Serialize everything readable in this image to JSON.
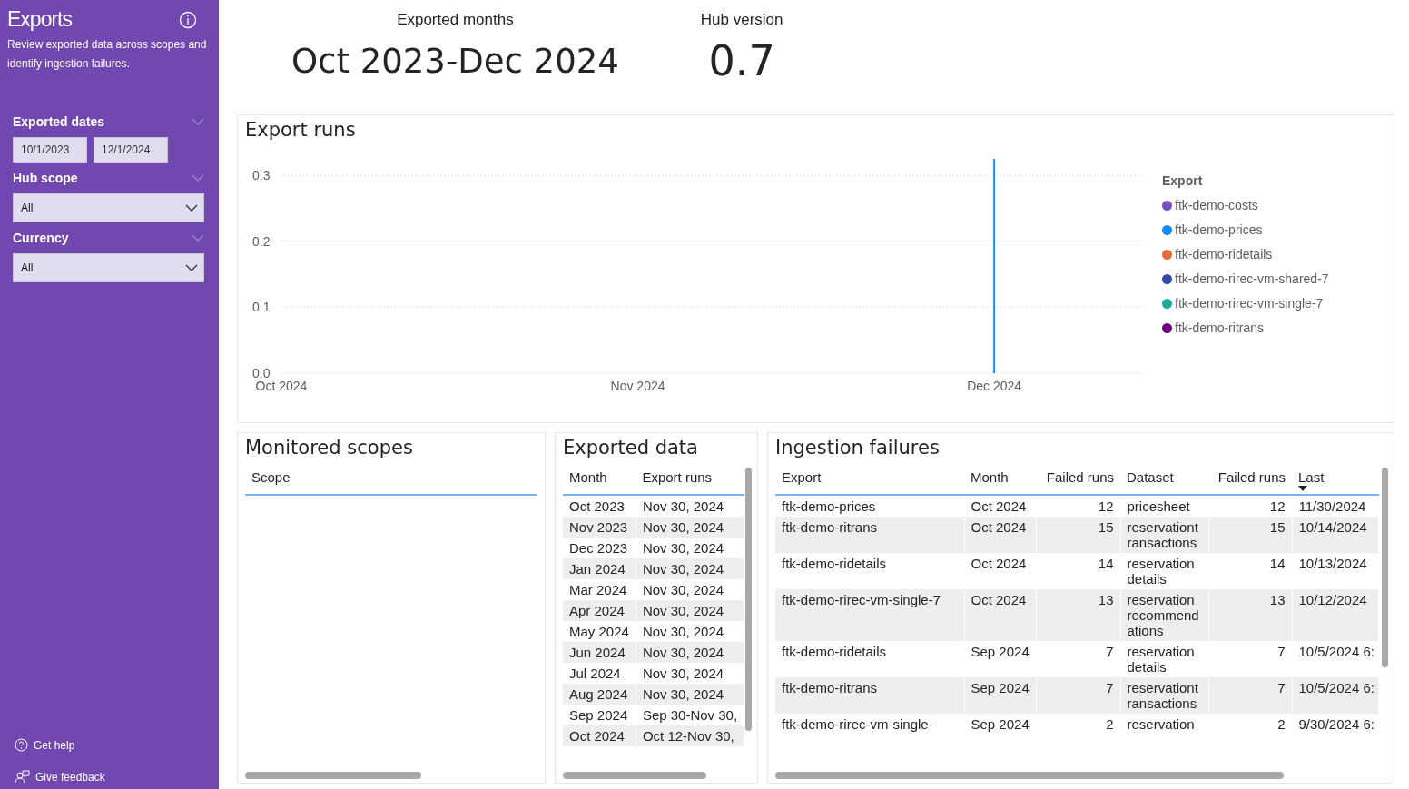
{
  "sidebar": {
    "title": "Exports",
    "subtitle": "Review exported data across scopes and identify ingestion failures.",
    "filters": [
      {
        "kind": "dates",
        "label": "Exported dates",
        "values": [
          "10/1/2023",
          "12/1/2024"
        ]
      },
      {
        "kind": "dropdown",
        "label": "Hub scope",
        "value": "All"
      },
      {
        "kind": "dropdown",
        "label": "Currency",
        "value": "All"
      }
    ],
    "footer_links": [
      {
        "kind": "help",
        "label": "Get help"
      },
      {
        "kind": "feedback",
        "label": "Give feedback"
      }
    ]
  },
  "kpis": [
    {
      "label": "Exported months",
      "value": "Oct 2023-Dec 2024"
    },
    {
      "label": "Hub version",
      "value": "0.7"
    }
  ],
  "export_runs": {
    "title": "Export runs",
    "chart_data": {
      "type": "line",
      "categories": [
        "Oct 2024",
        "Nov 2024",
        "Dec 2024"
      ],
      "ylim": [
        0,
        0.3
      ],
      "grid": true,
      "ref_lines": [
        {
          "axis": "x",
          "value": "Dec 2024",
          "color": "#118dff"
        }
      ],
      "yticks": [
        {
          "value": 0,
          "label": "0.0"
        },
        {
          "value": 0.1,
          "label": "0.1"
        },
        {
          "value": 0.2,
          "label": "0.2"
        },
        {
          "value": 0.3,
          "label": "0.3"
        }
      ],
      "legend_title": "Export",
      "series": [
        {
          "name": "ftk-demo-costs",
          "color": "#744ec2",
          "values": [
            null,
            null,
            null
          ]
        },
        {
          "name": "ftk-demo-prices",
          "color": "#118dff",
          "values": [
            null,
            null,
            null
          ]
        },
        {
          "name": "ftk-demo-ridetails",
          "color": "#e66c37",
          "values": [
            null,
            null,
            null
          ]
        },
        {
          "name": "ftk-demo-rirec-vm-shared-7",
          "color": "#3049ad",
          "values": [
            null,
            null,
            null
          ]
        },
        {
          "name": "ftk-demo-rirec-vm-single-7",
          "color": "#1aab9f",
          "values": [
            null,
            null,
            null
          ]
        },
        {
          "name": "ftk-demo-ritrans",
          "color": "#6b007b",
          "values": [
            null,
            null,
            null
          ]
        }
      ]
    }
  },
  "monitored_scopes": {
    "title": "Monitored scopes",
    "columns": [
      "Scope"
    ]
  },
  "exported_data": {
    "title": "Exported data",
    "columns": [
      "Month",
      "Export runs"
    ],
    "rows": [
      [
        "Oct 2023",
        "Nov 30, 2024"
      ],
      [
        "Nov 2023",
        "Nov 30, 2024"
      ],
      [
        "Dec 2023",
        "Nov 30, 2024"
      ],
      [
        "Jan 2024",
        "Nov 30, 2024"
      ],
      [
        "Mar 2024",
        "Nov 30, 2024"
      ],
      [
        "Apr 2024",
        "Nov 30, 2024"
      ],
      [
        "May 2024",
        "Nov 30, 2024"
      ],
      [
        "Jun 2024",
        "Nov 30, 2024"
      ],
      [
        "Jul 2024",
        "Nov 30, 2024"
      ],
      [
        "Aug 2024",
        "Nov 30, 2024"
      ],
      [
        "Sep 2024",
        "Sep 30-Nov 30,"
      ],
      [
        "Oct 2024",
        "Oct 12-Nov 30,"
      ]
    ]
  },
  "ingestion_failures": {
    "title": "Ingestion failures",
    "columns": [
      {
        "label": "Export",
        "sorted": false
      },
      {
        "label": "Month",
        "sorted": false
      },
      {
        "label": "Failed runs",
        "sorted": false
      },
      {
        "label": "Dataset",
        "sorted": false
      },
      {
        "label": "Failed runs",
        "sorted": false
      },
      {
        "label": "Last",
        "sorted": true
      }
    ],
    "rows": [
      [
        "ftk-demo-prices",
        "Oct 2024",
        "12",
        "pricesheet",
        "12",
        "11/30/2024"
      ],
      [
        "ftk-demo-ritrans",
        "Oct 2024",
        "15",
        "reservationtransactions",
        "15",
        "10/14/2024"
      ],
      [
        "ftk-demo-ridetails",
        "Oct 2024",
        "14",
        "reservation details",
        "14",
        "10/13/2024"
      ],
      [
        "ftk-demo-rirec-vm-single-7",
        "Oct 2024",
        "13",
        "reservation recommendations",
        "13",
        "10/12/2024"
      ],
      [
        "ftk-demo-ridetails",
        "Sep 2024",
        "7",
        "reservation details",
        "7",
        "10/5/2024 6:"
      ],
      [
        "ftk-demo-ritrans",
        "Sep 2024",
        "7",
        "reservationtransactions",
        "7",
        "10/5/2024 6:"
      ],
      [
        "ftk-demo-rirec-vm-single-",
        "Sep 2024",
        "2",
        "reservation",
        "2",
        "9/30/2024 6:"
      ]
    ]
  }
}
